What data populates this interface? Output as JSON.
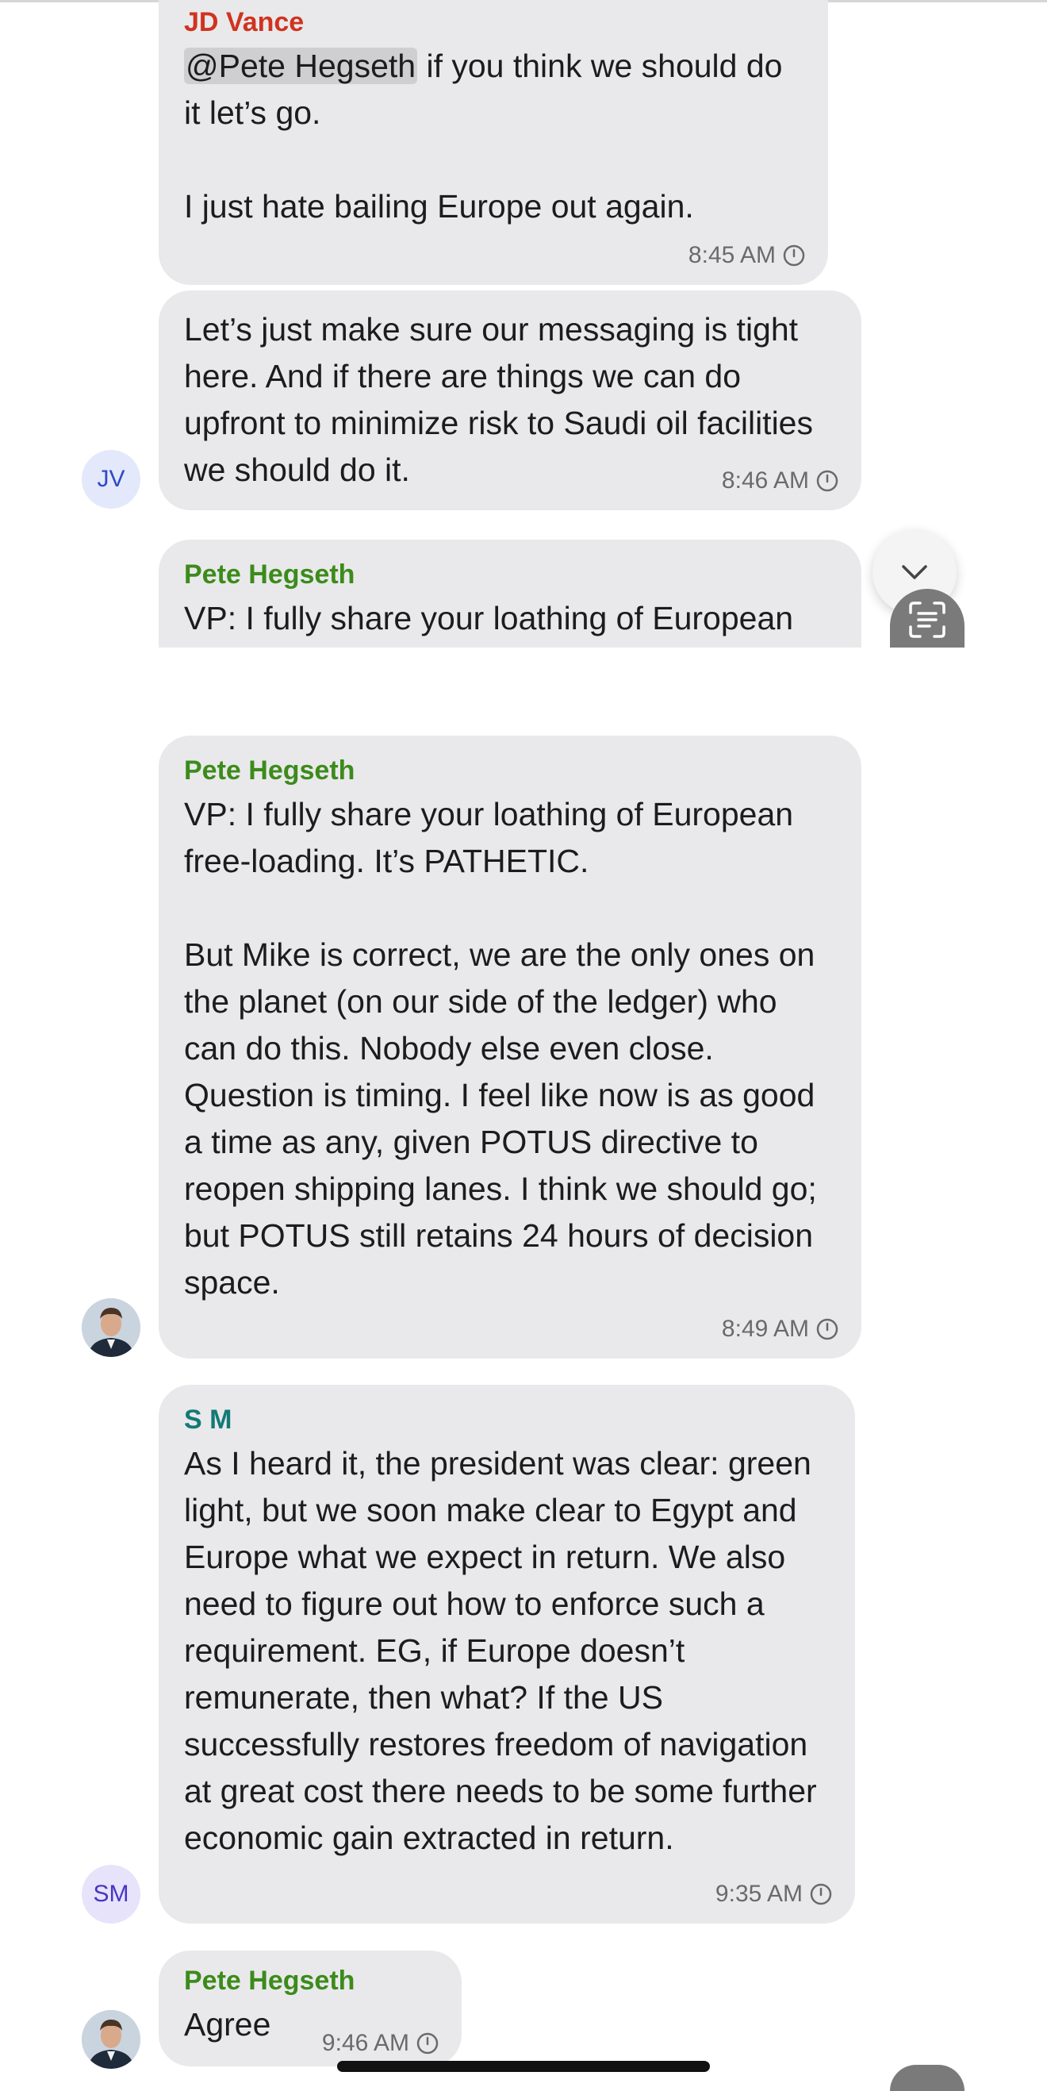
{
  "messages": {
    "m1": {
      "sender": "JD Vance",
      "mention": "@Pete Hegseth",
      "line1_rest": " if you think we should do it let’s go.",
      "para2": "I just hate bailing Europe out again.",
      "time": "8:45 AM"
    },
    "m2": {
      "text": "Let’s just make sure our messaging is tight here. And if there are things we can do upfront to minimize risk to Saudi oil facilities we should do it.",
      "time": "8:46 AM",
      "avatar_initials": "JV"
    },
    "m3_preview": {
      "sender": "Pete Hegseth",
      "text": "VP: I fully share your loathing of European free-loading. It’s PATHETIC."
    },
    "m3": {
      "sender": "Pete Hegseth",
      "para1": "VP: I fully share your loathing of European free-loading. It’s PATHETIC.",
      "para2": "But Mike is correct, we are the only ones on the planet (on our side of the ledger) who can do this. Nobody else even close. Question is timing. I feel like now is as good a time as any, given POTUS directive to reopen shipping lanes. I think we should go; but POTUS still retains 24 hours of decision space.",
      "time": "8:49 AM"
    },
    "m4": {
      "sender": "S M",
      "text": "As I heard it, the president was clear: green light, but we soon make clear to Egypt and Europe what we expect in return. We also need to figure out how to enforce such a requirement. EG, if Europe doesn’t remunerate, then what? If the US successfully restores freedom of navigation at great cost there needs to be some further economic gain extracted in return.",
      "time": "9:35 AM",
      "avatar_initials": "SM"
    },
    "m5": {
      "sender": "Pete Hegseth",
      "text": "Agree",
      "time": "9:46 AM"
    }
  },
  "icons": {
    "scroll_down": "chevron-down-icon",
    "scan_text": "text-scan-icon",
    "status": "clock-icon"
  },
  "colors": {
    "bubble": "#e9e9eb",
    "sender_red": "#d0331f",
    "sender_green": "#3c8b1b",
    "sender_teal": "#137a75"
  }
}
